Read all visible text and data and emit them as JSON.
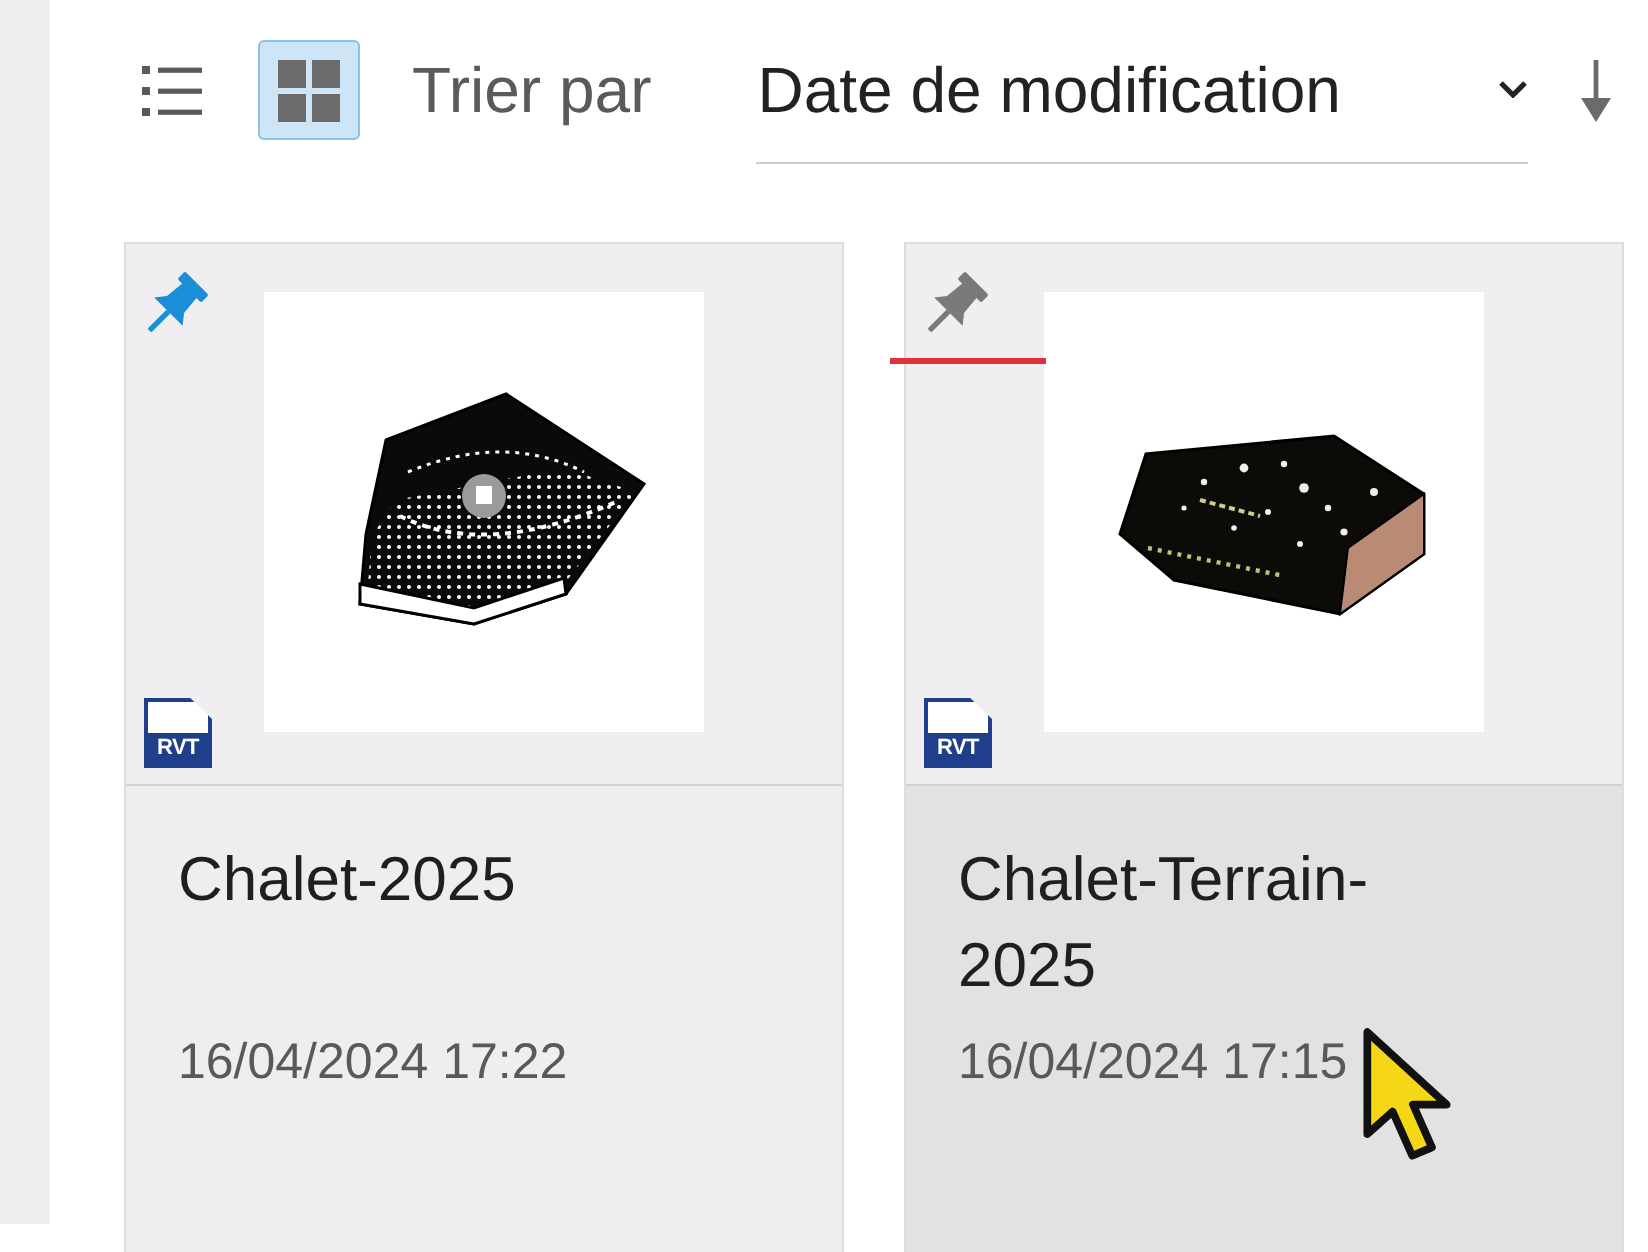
{
  "toolbar": {
    "view_modes": [
      {
        "kind": "list",
        "selected": false
      },
      {
        "kind": "grid",
        "selected": true
      }
    ],
    "sort_label": "Trier par",
    "sort_field": "Date de modification"
  },
  "files": [
    {
      "name": "Chalet-2025",
      "modified": "16/04/2024 17:22",
      "file_type": "RVT",
      "pinned": true,
      "hovered": false
    },
    {
      "name": "Chalet-Terrain-2025",
      "modified": "16/04/2024 17:15",
      "file_type": "RVT",
      "pinned": false,
      "hovered": true
    }
  ]
}
